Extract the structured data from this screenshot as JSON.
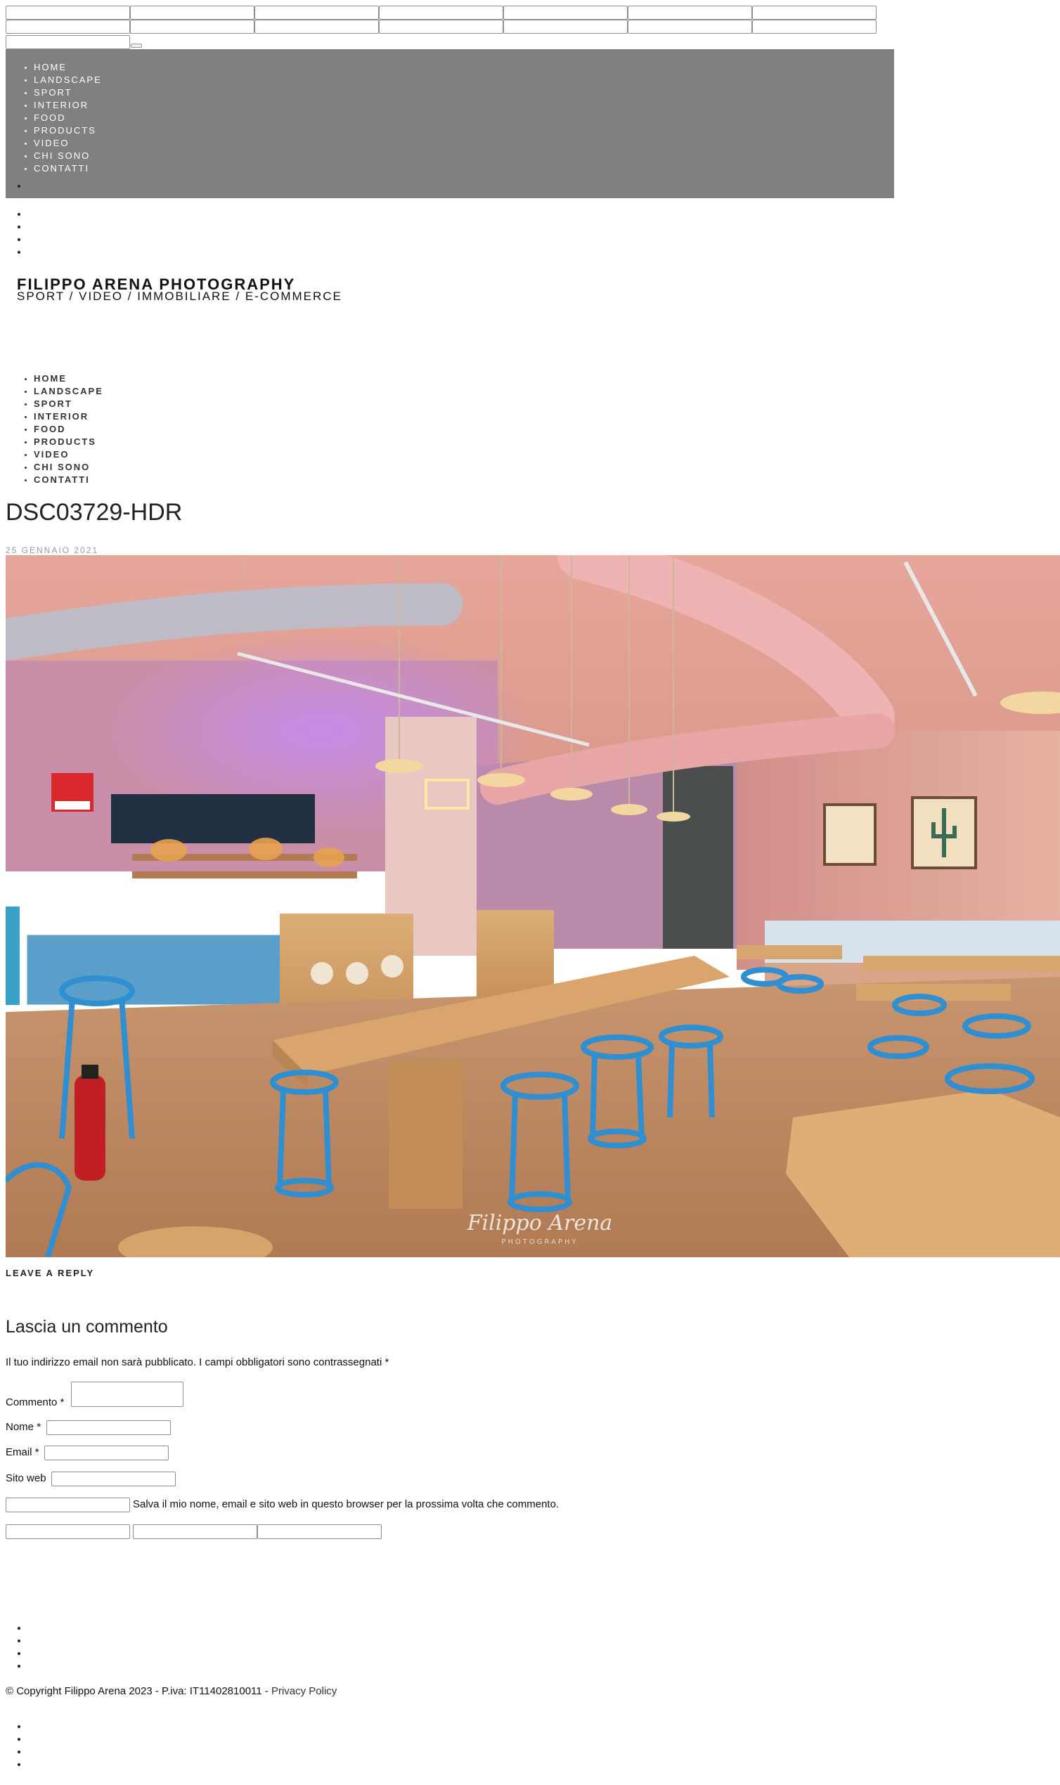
{
  "nav": {
    "items": [
      "HOME",
      "LANDSCAPE",
      "SPORT",
      "INTERIOR",
      "FOOD",
      "PRODUCTS",
      "VIDEO",
      "CHI SONO",
      "CONTATTI"
    ]
  },
  "brand": {
    "title": "FILIPPO ARENA PHOTOGRAPHY",
    "subtitle": "SPORT / VIDEO / IMMOBILIARE / E-COMMERCE"
  },
  "post": {
    "title": "DSC03729-HDR",
    "date": "25 GENNAIO 2021",
    "watermark_line1": "Filippo Arena",
    "watermark_line2": "PHOTOGRAPHY"
  },
  "reply": {
    "leave_reply": "LEAVE A REPLY",
    "title": "Lascia un commento",
    "notes": "Il tuo indirizzo email non sarà pubblicato. I campi obbligatori sono contrassegnati",
    "required_mark": "*",
    "comment_label": "Commento",
    "name_label": "Nome",
    "email_label": "Email",
    "website_label": "Sito web",
    "cookies_consent": "Salva il mio nome, email e sito web in questo browser per la prossima volta che commento."
  },
  "footer": {
    "copyright": "© Copyright Filippo Arena 2023 - P.iva: IT11402810011 - ",
    "privacy_link": "Privacy Policy"
  }
}
